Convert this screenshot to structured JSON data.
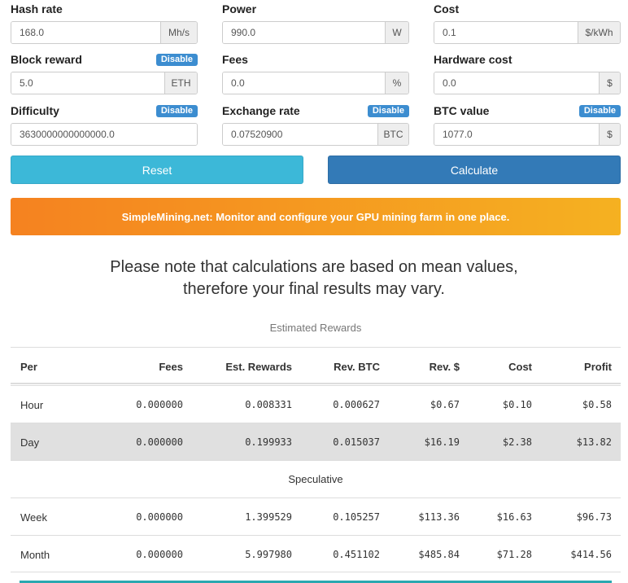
{
  "fields": {
    "hash_rate": {
      "label": "Hash rate",
      "value": "168.0",
      "unit": "Mh/s"
    },
    "power": {
      "label": "Power",
      "value": "990.0",
      "unit": "W"
    },
    "cost": {
      "label": "Cost",
      "value": "0.1",
      "unit": "$/kWh"
    },
    "block_reward": {
      "label": "Block reward",
      "badge": "Disable",
      "value": "5.0",
      "unit": "ETH"
    },
    "fees": {
      "label": "Fees",
      "value": "0.0",
      "unit": "%"
    },
    "hardware_cost": {
      "label": "Hardware cost",
      "value": "0.0",
      "unit": "$"
    },
    "difficulty": {
      "label": "Difficulty",
      "badge": "Disable",
      "value": "3630000000000000.0"
    },
    "exchange_rate": {
      "label": "Exchange rate",
      "badge": "Disable",
      "value": "0.07520900",
      "unit": "BTC"
    },
    "btc_value": {
      "label": "BTC value",
      "badge": "Disable",
      "value": "1077.0",
      "unit": "$"
    }
  },
  "buttons": {
    "reset": "Reset",
    "calculate": "Calculate"
  },
  "banner": "SimpleMining.net: Monitor and configure your GPU mining farm in one place.",
  "note": {
    "line1": "Please note that calculations are based on mean values,",
    "line2": "therefore your final results may vary."
  },
  "table": {
    "caption": "Estimated Rewards",
    "headers": [
      "Per",
      "Fees",
      "Est. Rewards",
      "Rev. BTC",
      "Rev. $",
      "Cost",
      "Profit"
    ],
    "rows": [
      [
        "Hour",
        "0.000000",
        "0.008331",
        "0.000627",
        "$0.67",
        "$0.10",
        "$0.58"
      ],
      [
        "Day",
        "0.000000",
        "0.199933",
        "0.015037",
        "$16.19",
        "$2.38",
        "$13.82"
      ]
    ],
    "speculative_label": "Speculative",
    "speculative_rows": [
      [
        "Week",
        "0.000000",
        "1.399529",
        "0.105257",
        "$113.36",
        "$16.63",
        "$96.73"
      ],
      [
        "Month",
        "0.000000",
        "5.997980",
        "0.451102",
        "$485.84",
        "$71.28",
        "$414.56"
      ]
    ]
  }
}
